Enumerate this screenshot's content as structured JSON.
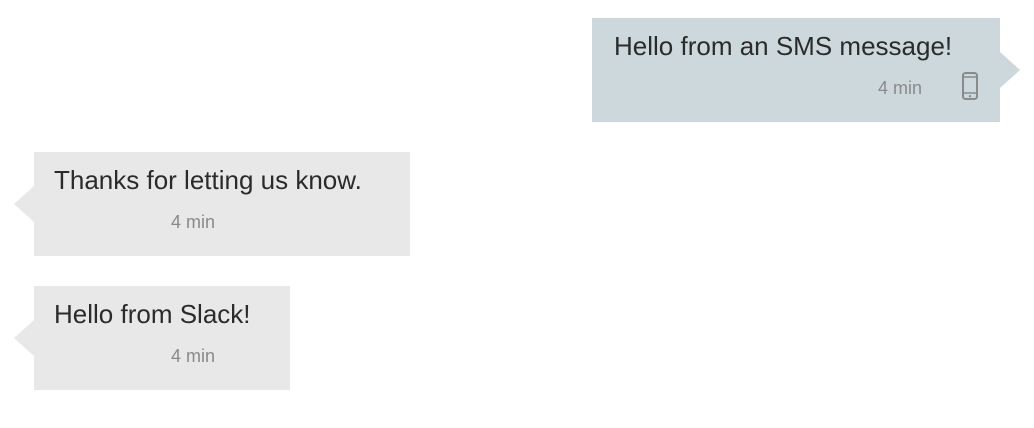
{
  "messages": [
    {
      "direction": "outgoing",
      "text": "Hello from an SMS message!",
      "time": "4 min",
      "channel_icon": "mobile-phone-icon",
      "bubble_color": "#ccd8dc"
    },
    {
      "direction": "incoming",
      "text": "Thanks for letting us know.",
      "time": "4 min",
      "bubble_color": "#e8e8e8"
    },
    {
      "direction": "incoming",
      "text": "Hello from Slack!",
      "time": "4 min",
      "bubble_color": "#e8e8e8"
    }
  ]
}
